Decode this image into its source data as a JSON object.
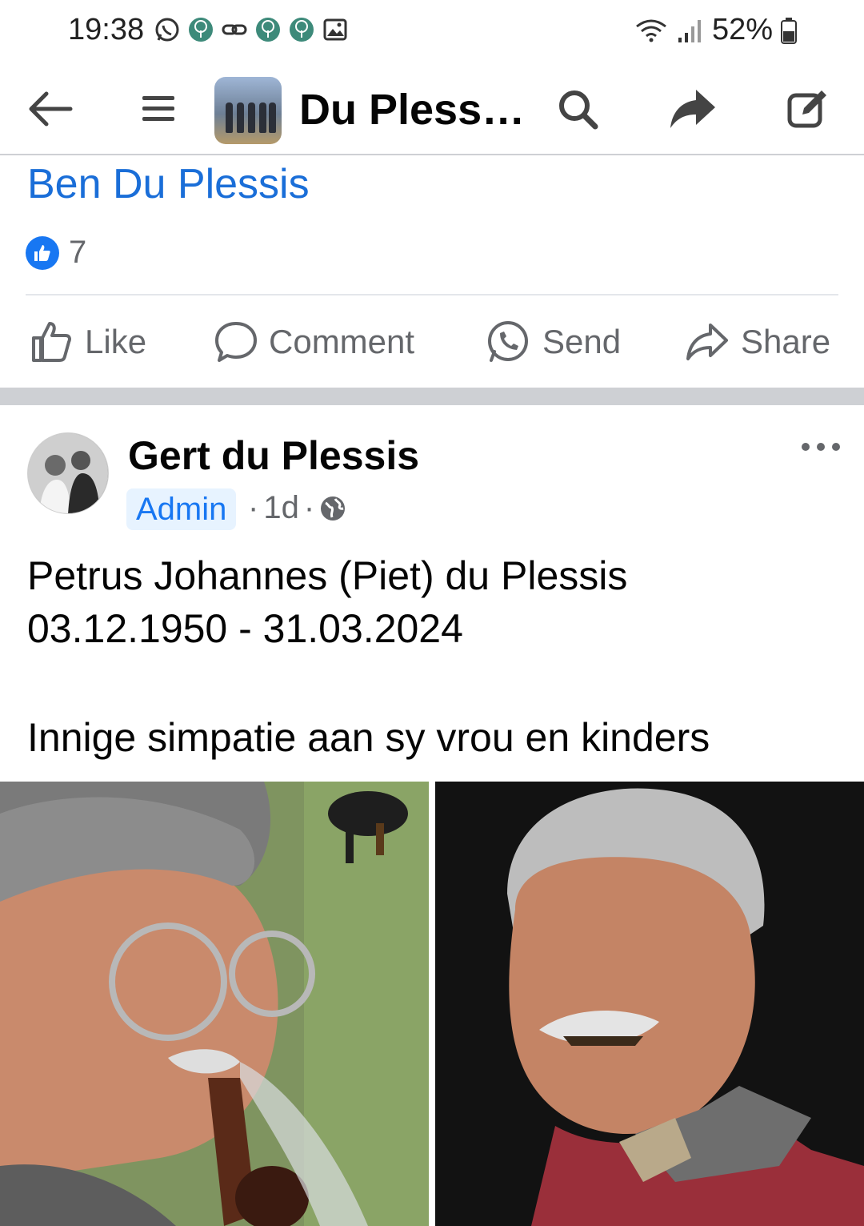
{
  "status_bar": {
    "time": "19:38",
    "battery": "52%",
    "left_icons": [
      "whatsapp-icon",
      "tree-app-icon",
      "link-icon",
      "tree-app-icon",
      "tree-app-icon",
      "image-icon"
    ],
    "right_icons": [
      "wifi-icon",
      "signal-icon",
      "battery-icon"
    ]
  },
  "header": {
    "title": "Du Pless…",
    "back_icon": "back-arrow-icon",
    "menu_icon": "hamburger-menu-icon",
    "search_icon": "search-icon",
    "share_icon": "share-arrow-icon",
    "edit_icon": "edit-icon"
  },
  "previous_post": {
    "author": "Ben Du Plessis",
    "like_count": "7",
    "actions": {
      "like": "Like",
      "comment": "Comment",
      "send": "Send",
      "share": "Share"
    }
  },
  "post": {
    "author": "Gert du Plessis",
    "badge": "Admin",
    "time": "1d",
    "separator": "·",
    "audience_icon": "globe-icon",
    "text_lines": [
      "Petrus Johannes (Piet) du Plessis",
      "03.12.1950 - 31.03.2024",
      "Innige simpatie aan sy vrou en kinders"
    ]
  },
  "colors": {
    "link_blue": "#1a6ed8",
    "facebook_blue": "#1877f2",
    "secondary_text": "#65676b",
    "divider": "#ced0d4"
  }
}
